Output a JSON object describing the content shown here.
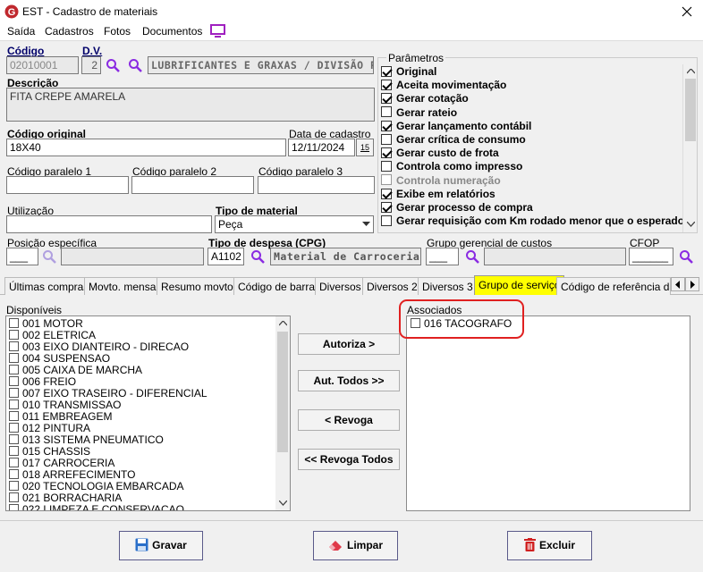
{
  "window": {
    "title": "EST - Cadastro de materiais"
  },
  "menu": [
    "Saída",
    "Cadastros",
    "Fotos",
    "Documentos"
  ],
  "codigo": {
    "label": "Código",
    "value": "02010001"
  },
  "dv": {
    "label": "D.V.",
    "value": "2"
  },
  "grupo_desc": "LUBRIFICANTES E GRAXAS / DIVISÃO PAI",
  "descricao": {
    "label": "Descrição",
    "value": "FITA CREPE AMARELA"
  },
  "codigo_original": {
    "label": "Código original",
    "value": "18X40"
  },
  "data_cadastro": {
    "label": "Data de cadastro",
    "value": "12/11/2024",
    "cal": "15"
  },
  "paralelo1": {
    "label": "Código paralelo 1",
    "value": ""
  },
  "paralelo2": {
    "label": "Código paralelo 2",
    "value": ""
  },
  "paralelo3": {
    "label": "Código paralelo 3",
    "value": ""
  },
  "utilizacao": {
    "label": "Utilização",
    "value": ""
  },
  "tipo_material": {
    "label": "Tipo de material",
    "value": "Peça"
  },
  "posicao": {
    "label": "Posição específica",
    "value": "___",
    "desc": ""
  },
  "tipo_despesa": {
    "label": "Tipo de despesa (CPG)",
    "value": "A1102",
    "desc": "Material de Carrocerias  (EST"
  },
  "grupo_gerencial": {
    "label": "Grupo gerencial de custos",
    "value": "___",
    "desc": ""
  },
  "cfop": {
    "label": "CFOP",
    "value": "______"
  },
  "parametros": {
    "label": "Parâmetros",
    "items": [
      {
        "label": "Original",
        "checked": true,
        "disabled": false
      },
      {
        "label": "Aceita movimentação",
        "checked": true,
        "disabled": false
      },
      {
        "label": "Gerar cotação",
        "checked": true,
        "disabled": false
      },
      {
        "label": "Gerar rateio",
        "checked": false,
        "disabled": false
      },
      {
        "label": "Gerar lançamento contábil",
        "checked": true,
        "disabled": false
      },
      {
        "label": "Gerar crítica de consumo",
        "checked": false,
        "disabled": false
      },
      {
        "label": "Gerar custo de frota",
        "checked": true,
        "disabled": false
      },
      {
        "label": "Controla como impresso",
        "checked": false,
        "disabled": false
      },
      {
        "label": "Controla numeração",
        "checked": false,
        "disabled": true
      },
      {
        "label": "Exibe em relatórios",
        "checked": true,
        "disabled": false
      },
      {
        "label": "Gerar processo de compra",
        "checked": true,
        "disabled": false
      },
      {
        "label": "Gerar requisição com Km rodado menor que o esperado",
        "checked": false,
        "disabled": false
      }
    ]
  },
  "tabs": [
    "Últimas compras",
    "Movto. mensal",
    "Resumo movto.",
    "Código de barras",
    "Diversos",
    "Diversos 2",
    "Diversos 3",
    "Grupo de serviço",
    "Código de referência da m"
  ],
  "active_tab": "Grupo de serviço",
  "disponiveis": {
    "label": "Disponíveis",
    "items": [
      "001 MOTOR",
      "002 ELETRICA",
      "003 EIXO DIANTEIRO - DIRECAO",
      "004 SUSPENSAO",
      "005 CAIXA DE MARCHA",
      "006 FREIO",
      "007 EIXO TRASEIRO - DIFERENCIAL",
      "010 TRANSMISSAO",
      "011 EMBREAGEM",
      "012 PINTURA",
      "013 SISTEMA PNEUMATICO",
      "015 CHASSIS",
      "017 CARROCERIA",
      "018 ARREFECIMENTO",
      "020 TECNOLOGIA EMBARCADA",
      "021 BORRACHARIA",
      "022 LIMPEZA E CONSERVACAO"
    ]
  },
  "associados": {
    "label": "Associados",
    "items": [
      "016 TACOGRAFO"
    ]
  },
  "actions": {
    "autoriza": "Autoriza >",
    "aut_todos": "Aut. Todos >>",
    "revoga": "< Revoga",
    "revoga_todos": "<< Revoga Todos"
  },
  "footer": {
    "gravar": "Gravar",
    "limpar": "Limpar",
    "excluir": "Excluir"
  },
  "colors": {
    "accent_tab": "#ffff00",
    "highlight_border": "#e02020",
    "logo": "#c0282d",
    "monitor_icon": "#a020c0"
  }
}
